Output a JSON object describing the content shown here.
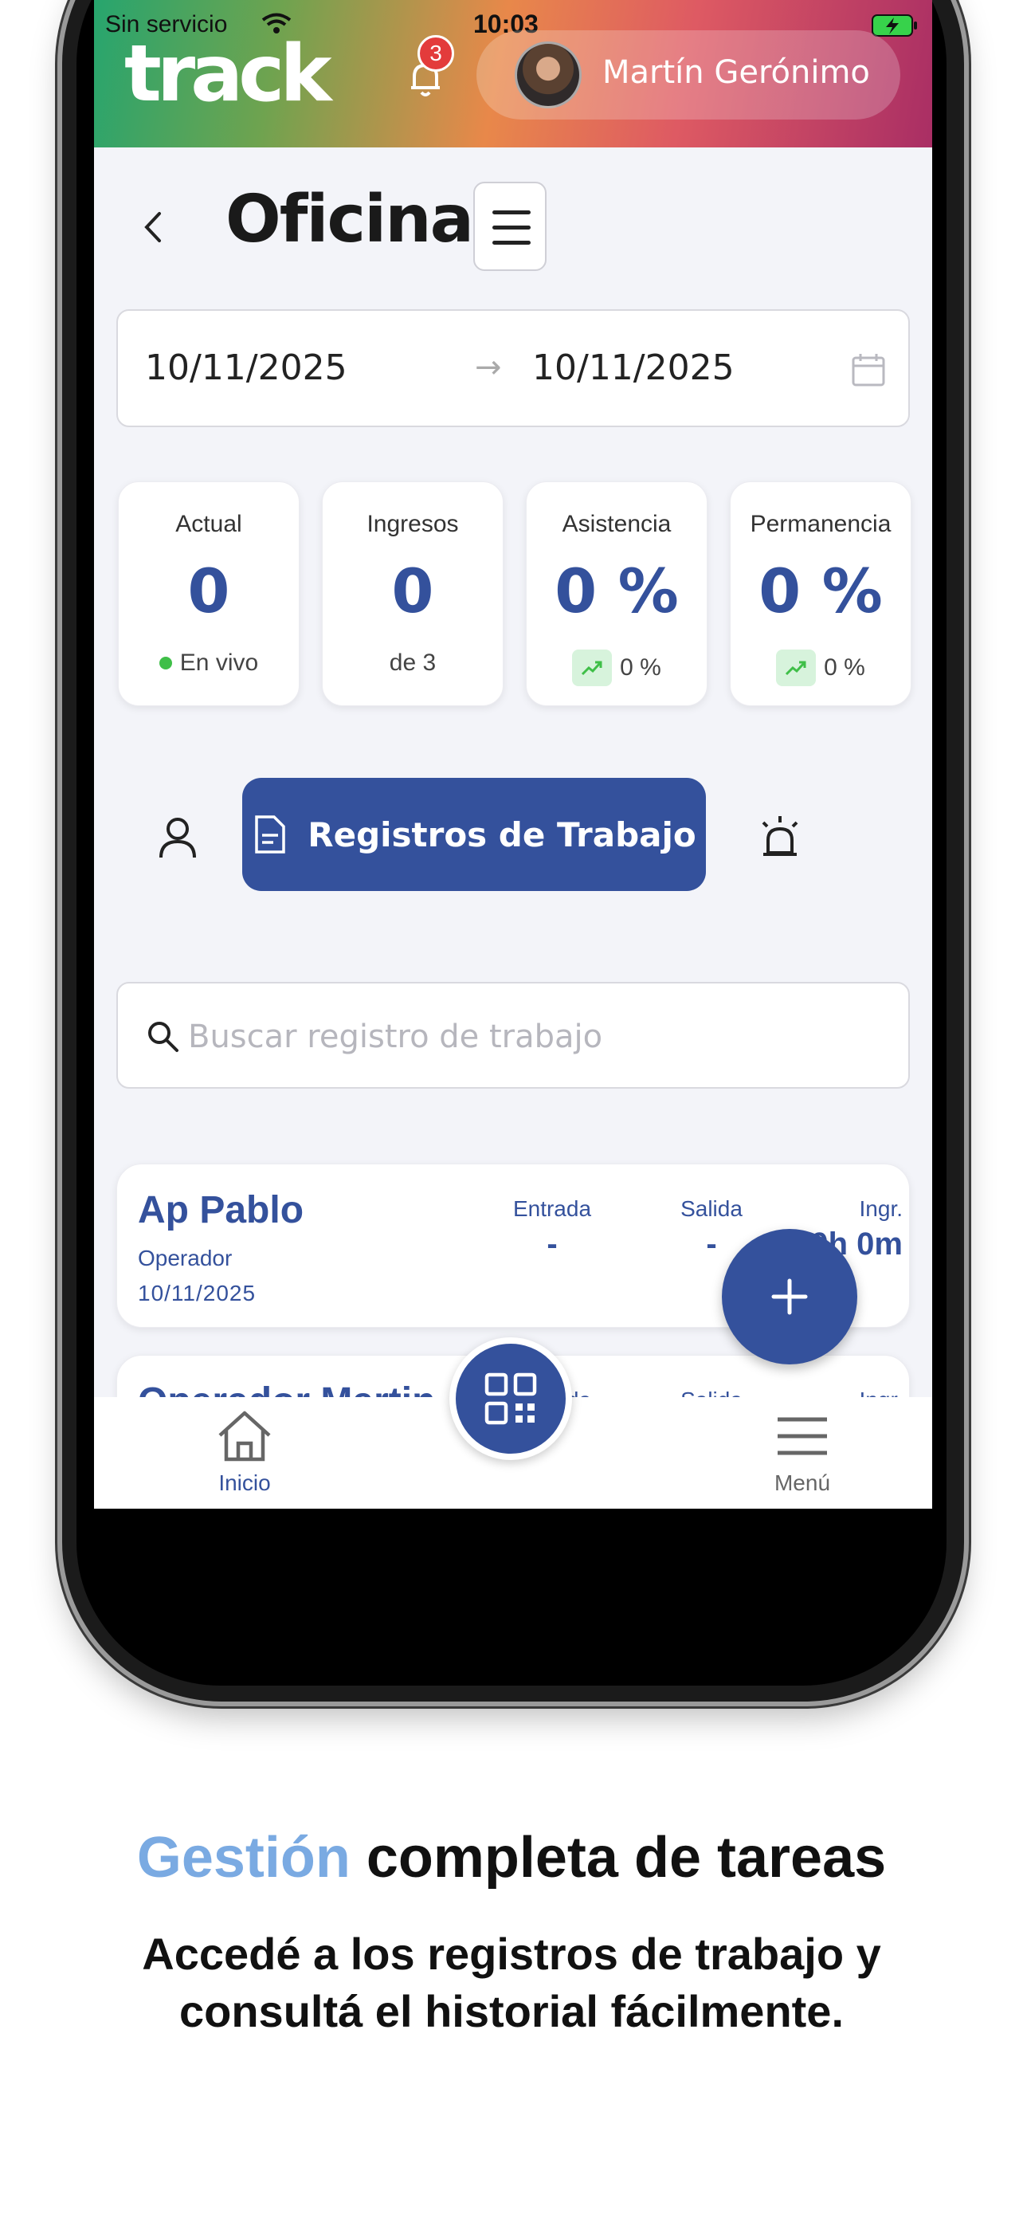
{
  "status_bar": {
    "carrier": "Sin servicio",
    "time": "10:03"
  },
  "header": {
    "logo_text": "track",
    "notification_count": "3",
    "user_name": "Martín Gerónimo"
  },
  "page": {
    "title": "Oficina"
  },
  "date_range": {
    "start": "10/11/2025",
    "arrow": "→",
    "end": "10/11/2025"
  },
  "stats": [
    {
      "label": "Actual",
      "value": "0",
      "sub": "En vivo"
    },
    {
      "label": "Ingresos",
      "value": "0",
      "sub": "de 3"
    },
    {
      "label": "Asistencia",
      "value": "0 %",
      "sub": "0 %"
    },
    {
      "label": "Permanencia",
      "value": "0 %",
      "sub": "0 %"
    }
  ],
  "tabs": {
    "active_label": "Registros de Trabajo"
  },
  "search": {
    "placeholder": "Buscar registro de trabajo",
    "value": ""
  },
  "records": [
    {
      "name": "Ap Pablo",
      "role": "Operador",
      "date": "10/11/2025",
      "col_entrada": "Entrada",
      "col_salida": "Salida",
      "col_ingr": "Ingr.",
      "entrada": "-",
      "salida": "-",
      "ingr": "0h 0m"
    },
    {
      "name": "Operador Martin",
      "col_entrada": "Entrada",
      "col_salida": "Salida",
      "col_ingr": "Ingr."
    }
  ],
  "bottom_nav": {
    "home_label": "Inicio",
    "menu_label": "Menú"
  },
  "caption": {
    "headline_accent": "Gestión",
    "headline_rest": " completa de tareas",
    "subline": "Accedé a los registros de trabajo y consultá el historial fácilmente."
  },
  "colors": {
    "primary": "#34519c",
    "accent_caption": "#7aaae2",
    "live": "#3fbf48",
    "badge": "#e33b3b"
  }
}
